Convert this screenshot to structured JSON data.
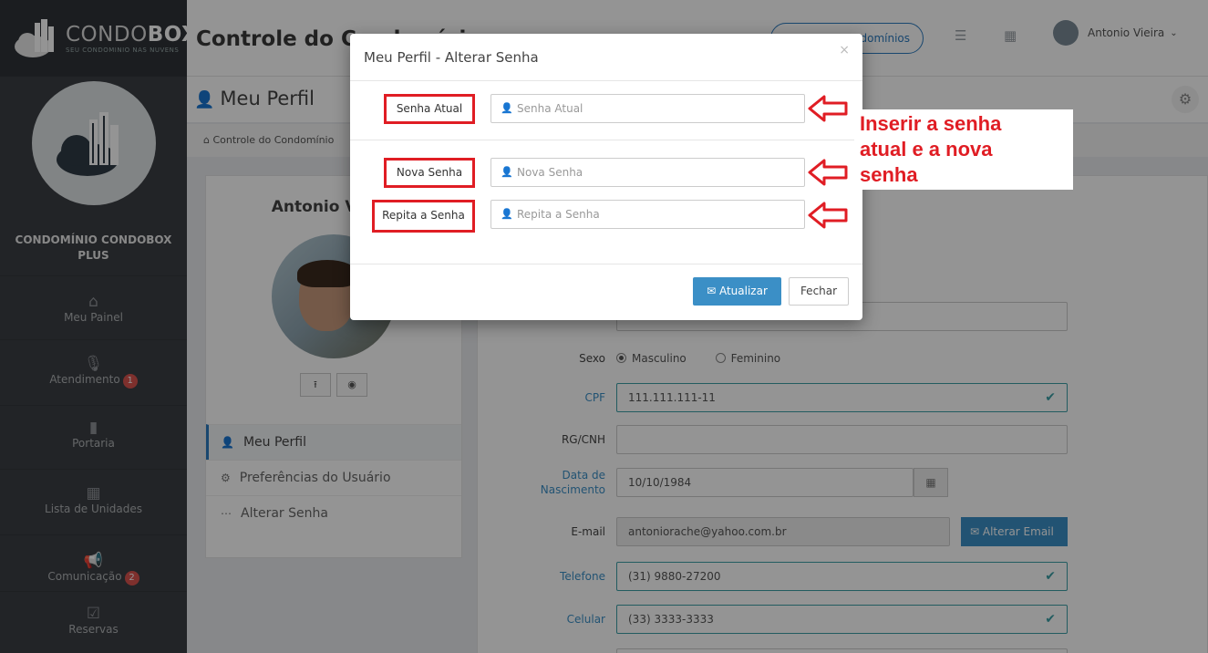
{
  "brand": {
    "name_light": "CONDO",
    "name_bold": "BOX",
    "tagline": "SEU CONDOMINIO NAS NUVENS"
  },
  "sidebar": {
    "condo_name": "CONDOMÍNIO CONDOBOX PLUS",
    "items": [
      {
        "label": "Meu Painel",
        "icon": "home-icon"
      },
      {
        "label": "Atendimento",
        "icon": "microphone-icon",
        "badge": "1"
      },
      {
        "label": "Portaria",
        "icon": "door-icon"
      },
      {
        "label": "Lista de Unidades",
        "icon": "building-icon"
      },
      {
        "label": "Comunicação",
        "icon": "megaphone-icon",
        "badge": "2"
      },
      {
        "label": "Reservas",
        "icon": "calendar-check-icon"
      }
    ]
  },
  "header": {
    "title": "Controle do Condomínio",
    "condos_button": "Meus Condomínios",
    "user_name": "Antonio Vieira"
  },
  "page": {
    "title": "Meu Perfil",
    "breadcrumb": "Controle do Condomínio"
  },
  "profile": {
    "name": "Antonio Vieira",
    "menu": [
      {
        "label": "Meu Perfil",
        "icon": "user-icon",
        "active": true
      },
      {
        "label": "Preferências do Usuário",
        "icon": "gears-icon",
        "active": false
      },
      {
        "label": "Alterar Senha",
        "icon": "ellipsis-icon",
        "active": false
      }
    ]
  },
  "form": {
    "sexo_label": "Sexo",
    "sexo_options": [
      "Masculino",
      "Feminino"
    ],
    "sexo_selected": "Masculino",
    "cpf_label": "CPF",
    "cpf_value": "111.111.111-11",
    "rg_label": "RG/CNH",
    "rg_value": "",
    "nasc_label_1": "Data de",
    "nasc_label_2": "Nascimento",
    "nasc_value": "10/10/1984",
    "email_label": "E-mail",
    "email_value": "antoniorache@yahoo.com.br",
    "email_button": "Alterar Email",
    "telefone_label": "Telefone",
    "telefone_value": "(31) 9880-27200",
    "celular_label": "Celular",
    "celular_value": "(33) 3333-3333"
  },
  "modal": {
    "title": "Meu Perfil - Alterar Senha",
    "current_label": "Senha Atual",
    "current_placeholder": "Senha Atual",
    "new_label": "Nova Senha",
    "new_placeholder": "Nova Senha",
    "repeat_label": "Repita a Senha",
    "repeat_placeholder": "Repita a Senha",
    "update_button": "Atualizar",
    "close_button": "Fechar"
  },
  "annotation": {
    "line1": "Inserir a senha",
    "line2": "atual e a nova",
    "line3": "senha",
    "color": "#e01d24"
  }
}
